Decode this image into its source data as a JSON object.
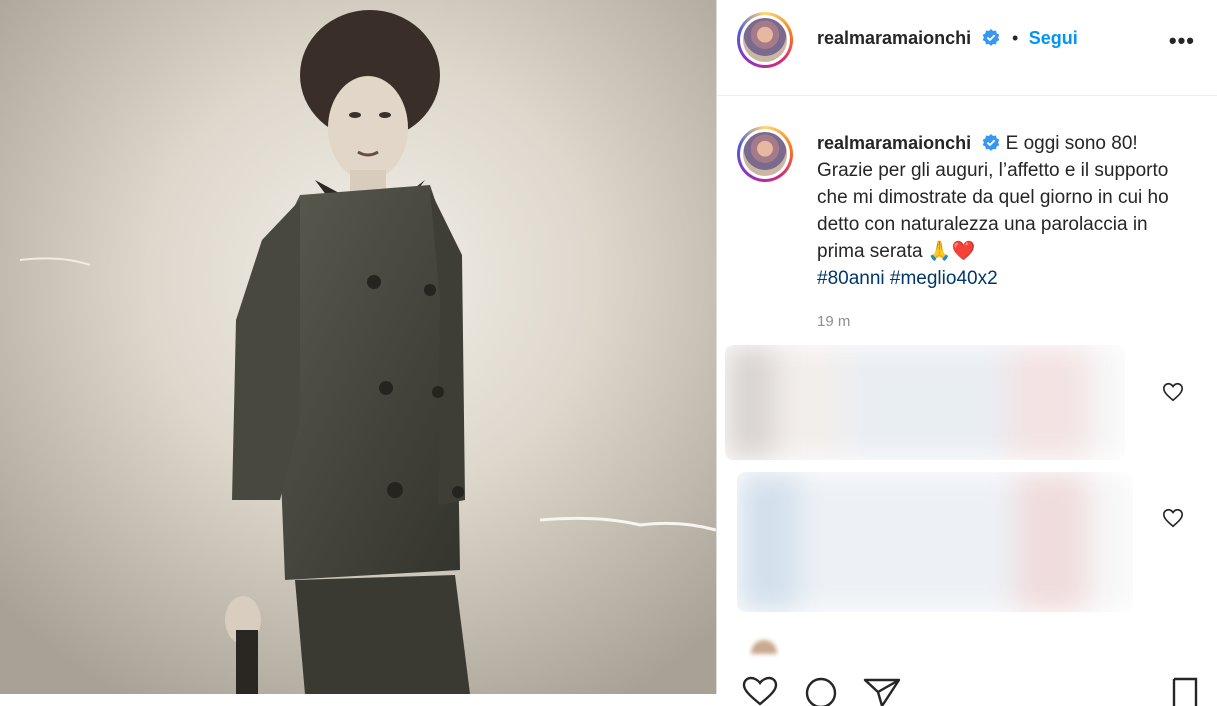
{
  "post": {
    "username": "realmaramaionchi",
    "follow_label": "Segui",
    "separator": "•",
    "more_label": "•••",
    "caption_text": "E oggi sono 80! Grazie per gli auguri, l’affetto e il supporto che mi dimostrate da quel giorno in cui ho detto con naturalezza una parolaccia in prima serata 🙏❤️",
    "hashtags": [
      "#80anni",
      "#meglio40x2"
    ],
    "timestamp": "19 m"
  },
  "icons": {
    "verified": "verified-badge-icon",
    "more": "more-options-icon",
    "like": "heart-icon",
    "comment": "comment-icon",
    "share": "share-icon",
    "save": "bookmark-icon"
  },
  "colors": {
    "accent": "#0095f6",
    "hashtag": "#00376b",
    "text": "#262626",
    "muted": "#8e8e8e",
    "verified": "#3897f0"
  }
}
